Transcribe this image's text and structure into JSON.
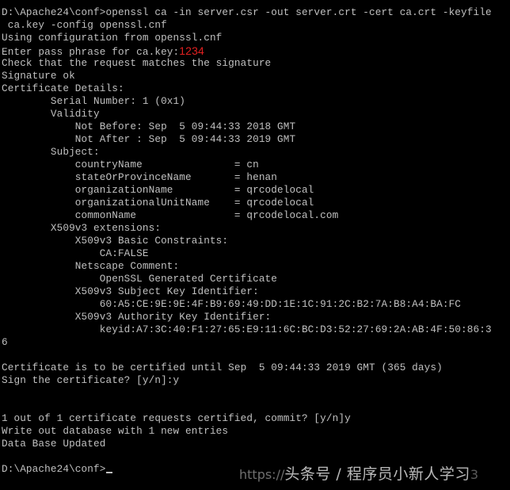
{
  "console": {
    "lines": [
      "D:\\Apache24\\conf>openssl ca -in server.csr -out server.crt -cert ca.crt -keyfile",
      " ca.key -config openssl.cnf",
      "Using configuration from openssl.cnf",
      "Enter pass phrase for ca.key:",
      "Check that the request matches the signature",
      "Signature ok",
      "Certificate Details:",
      "        Serial Number: 1 (0x1)",
      "        Validity",
      "            Not Before: Sep  5 09:44:33 2018 GMT",
      "            Not After : Sep  5 09:44:33 2019 GMT",
      "        Subject:",
      "            countryName               = cn",
      "            stateOrProvinceName       = henan",
      "            organizationName          = qrcodelocal",
      "            organizationalUnitName    = qrcodelocal",
      "            commonName                = qrcodelocal.com",
      "        X509v3 extensions:",
      "            X509v3 Basic Constraints:",
      "                CA:FALSE",
      "            Netscape Comment:",
      "                OpenSSL Generated Certificate",
      "            X509v3 Subject Key Identifier:",
      "                60:A5:CE:9E:9E:4F:B9:69:49:DD:1E:1C:91:2C:B2:7A:B8:A4:BA:FC",
      "            X509v3 Authority Key Identifier:",
      "                keyid:A7:3C:40:F1:27:65:E9:11:6C:BC:D3:52:27:69:2A:AB:4F:50:86:3",
      "6",
      "",
      "Certificate is to be certified until Sep  5 09:44:33 2019 GMT (365 days)",
      "Sign the certificate? [y/n]:y",
      "",
      "",
      "1 out of 1 certificate requests certified, commit? [y/n]y",
      "Write out database with 1 new entries",
      "Data Base Updated",
      "",
      "D:\\Apache24\\conf>"
    ],
    "pass_phrase_annotation": "1234",
    "annotation_color": "#e02020",
    "text_color": "#c0c0c0",
    "background_color": "#000000"
  },
  "watermark": {
    "url_prefix": "https://",
    "text": "头条号 / 程序员小新人学习",
    "url_suffix": "3"
  }
}
